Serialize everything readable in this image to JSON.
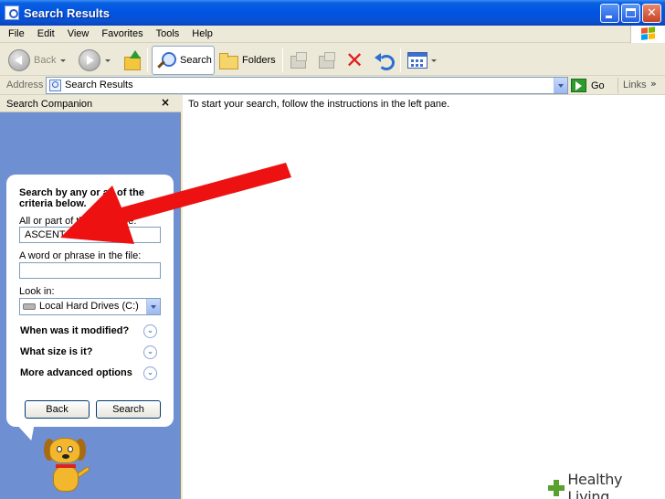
{
  "window": {
    "title": "Search Results",
    "accent": "#0054e3"
  },
  "menu": {
    "items": [
      "File",
      "Edit",
      "View",
      "Favorites",
      "Tools",
      "Help"
    ]
  },
  "toolbar": {
    "back_label": "Back",
    "search_label": "Search",
    "folders_label": "Folders"
  },
  "address": {
    "label": "Address",
    "value": "Search Results",
    "go_label": "Go",
    "links_label": "Links",
    "chevron": "»"
  },
  "pane": {
    "title": "Search Companion",
    "close_glyph": "×",
    "heading": "Search by any or all of the criteria below.",
    "name_label": "All or part of the file name:",
    "name_value": "ASCENT",
    "phrase_label": "A word or phrase in the file:",
    "phrase_value": "",
    "lookin_label": "Look in:",
    "lookin_value": "Local Hard Drives (C:)",
    "expanders": [
      "When was it modified?",
      "What size is it?",
      "More advanced options"
    ],
    "expander_glyph": "⌄",
    "back_button": "Back",
    "search_button": "Search"
  },
  "content": {
    "message": "To start your search, follow the instructions in the left pane."
  },
  "overlay": {
    "arrow_color": "#ee1111"
  },
  "watermark": {
    "text": "Healthy Living"
  }
}
